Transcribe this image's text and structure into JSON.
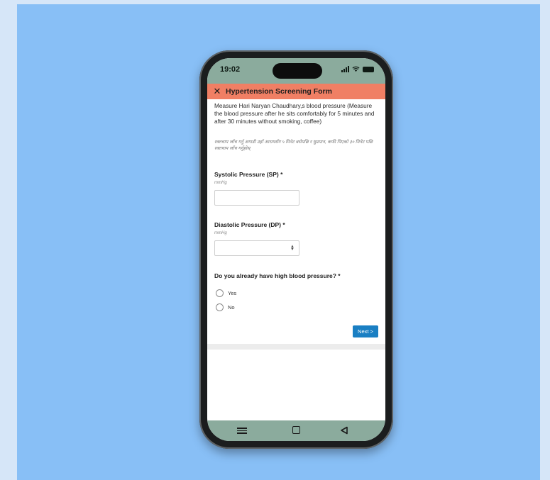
{
  "status_bar": {
    "time": "19:02"
  },
  "header": {
    "title": "Hypertension Screening Form"
  },
  "form": {
    "instructions": "Measure Hari Naryan Chaudhary,s blood pressure (Measure the blood pressure after he sits comfortably for 5 minutes and after 30 minutes without smoking, coffee)",
    "instructions_nepali": "रक्तचाप जाँच गर्नु अगाडी उहाँ आरामसँग ५ मिनेट बसेपछि र धुम्रपान, कफी पिएको ३० मिनेट पछि रक्तचाप जाँच गर्नुहोस्",
    "systolic": {
      "label": "Systolic Pressure (SP) *",
      "unit": "mmHg",
      "value": ""
    },
    "diastolic": {
      "label": "Diastolic Pressure (DP) *",
      "unit": "mmHg",
      "value": ""
    },
    "question": {
      "label": "Do you already have high blood pressure? *",
      "options": [
        "Yes",
        "No"
      ]
    },
    "next_label": "Next >"
  }
}
